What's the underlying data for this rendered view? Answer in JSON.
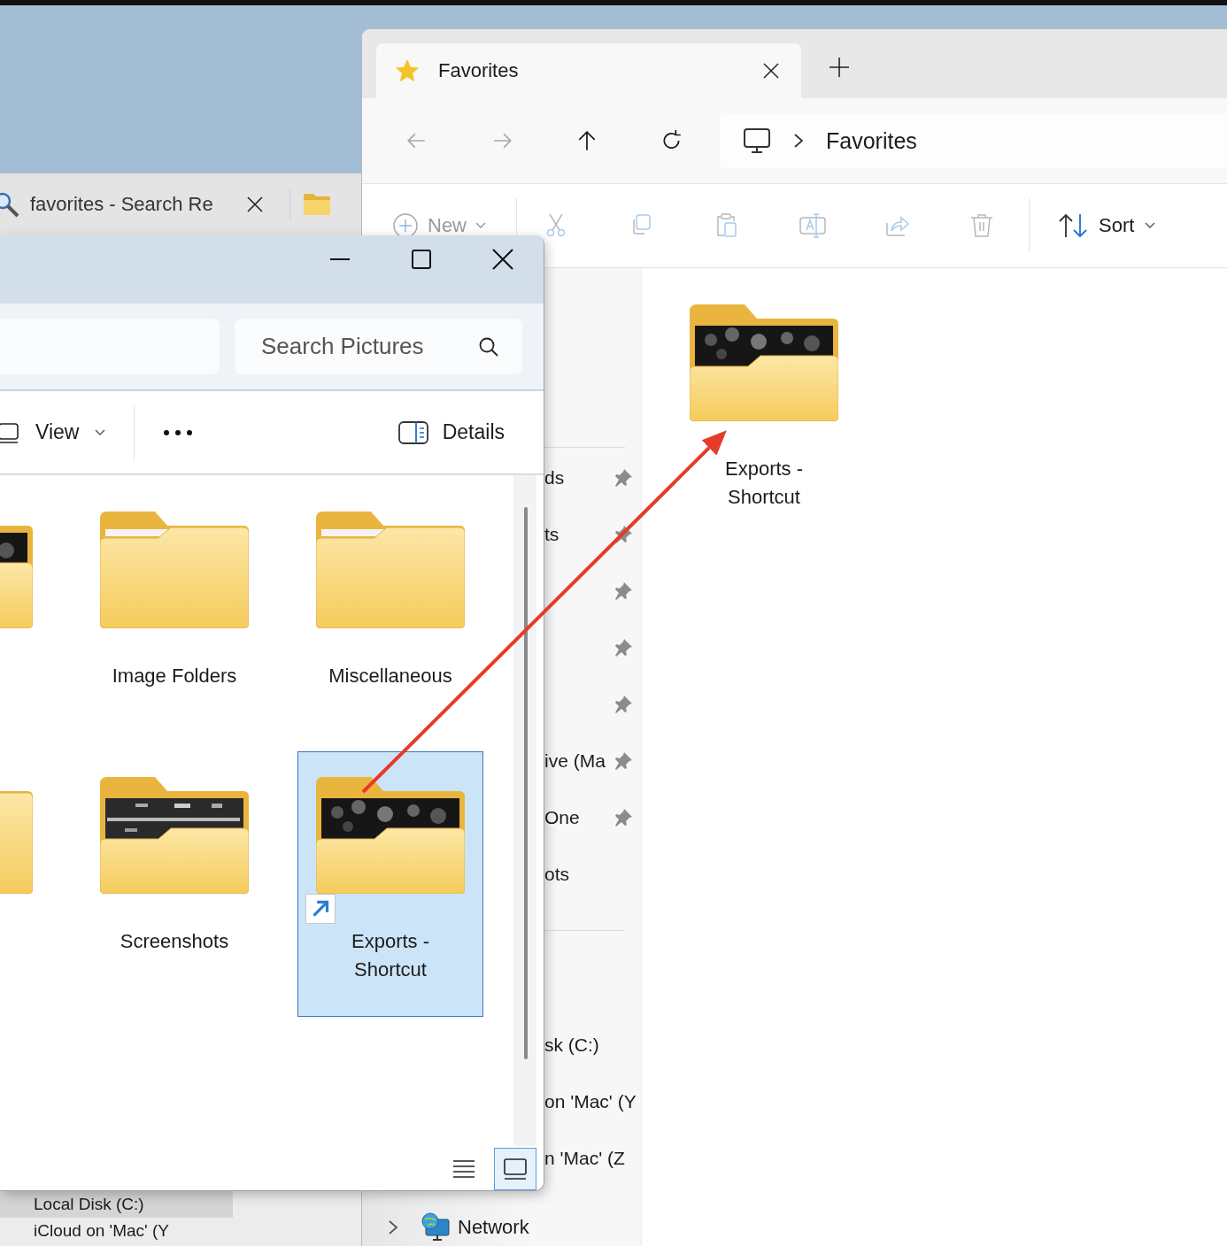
{
  "back_window": {
    "tabs": [
      {
        "title": "favorites - Search Re"
      }
    ],
    "sidebar": [
      {
        "label": "Local Disk (C:)",
        "selected": true
      },
      {
        "label": "iCloud on 'Mac' (Y",
        "selected": false
      }
    ]
  },
  "favorites_window": {
    "tabs": [
      {
        "title": "Favorites",
        "selected": true
      }
    ],
    "nav": [
      {
        "kind": "back",
        "disabled": true
      },
      {
        "kind": "forward",
        "disabled": true
      },
      {
        "kind": "up",
        "disabled": false
      },
      {
        "kind": "refresh",
        "disabled": false
      }
    ],
    "address": [
      "Favorites"
    ],
    "toolbar": {
      "new_label": "New",
      "new_disabled": true,
      "actions": [
        {
          "kind": "cut",
          "disabled": true
        },
        {
          "kind": "copy",
          "disabled": true
        },
        {
          "kind": "paste",
          "disabled": true
        },
        {
          "kind": "rename",
          "disabled": true
        },
        {
          "kind": "share",
          "disabled": true
        },
        {
          "kind": "delete",
          "disabled": true
        }
      ],
      "sort_label": "Sort"
    },
    "sidebar": {
      "quick_access": [
        {
          "label": "ds",
          "pinned": true
        },
        {
          "label": "ts",
          "pinned": true
        },
        {
          "pinned": true
        },
        {
          "pinned": true
        },
        {
          "pinned": true
        },
        {
          "label": "ive (Ma",
          "pinned": true
        },
        {
          "label": "One",
          "pinned": true
        },
        {
          "label": "ots",
          "pinned": false
        }
      ],
      "drives": [
        {
          "label": "sk (C:)"
        },
        {
          "label": "on 'Mac' (Y"
        },
        {
          "label": "n 'Mac' (Z"
        }
      ],
      "network": {
        "label": "Network",
        "expanded": false
      }
    },
    "items": [
      {
        "name": "Exports - Shortcut",
        "kind": "photo",
        "shortcut": false,
        "selected": false
      }
    ]
  },
  "pictures_window": {
    "search": {
      "placeholder": "Search Pictures"
    },
    "toolbar": {
      "view_label": "View",
      "details_label": "Details"
    },
    "items": [
      {
        "kind": "photo",
        "shortcut": false,
        "selected": false
      },
      {
        "name": "Image Folders",
        "kind": "plain",
        "shortcut": false,
        "selected": false
      },
      {
        "name": "Miscellaneous",
        "kind": "plain",
        "shortcut": false,
        "selected": false
      },
      {
        "kind": "plain",
        "shortcut": false,
        "selected": false
      },
      {
        "name": "Screenshots",
        "kind": "screenshot",
        "shortcut": false,
        "selected": false
      },
      {
        "name": "Exports - Shortcut",
        "kind": "photo",
        "shortcut": true,
        "selected": true
      }
    ],
    "view_modes": [
      {
        "kind": "list",
        "selected": false
      },
      {
        "kind": "tiles",
        "selected": true
      }
    ]
  }
}
